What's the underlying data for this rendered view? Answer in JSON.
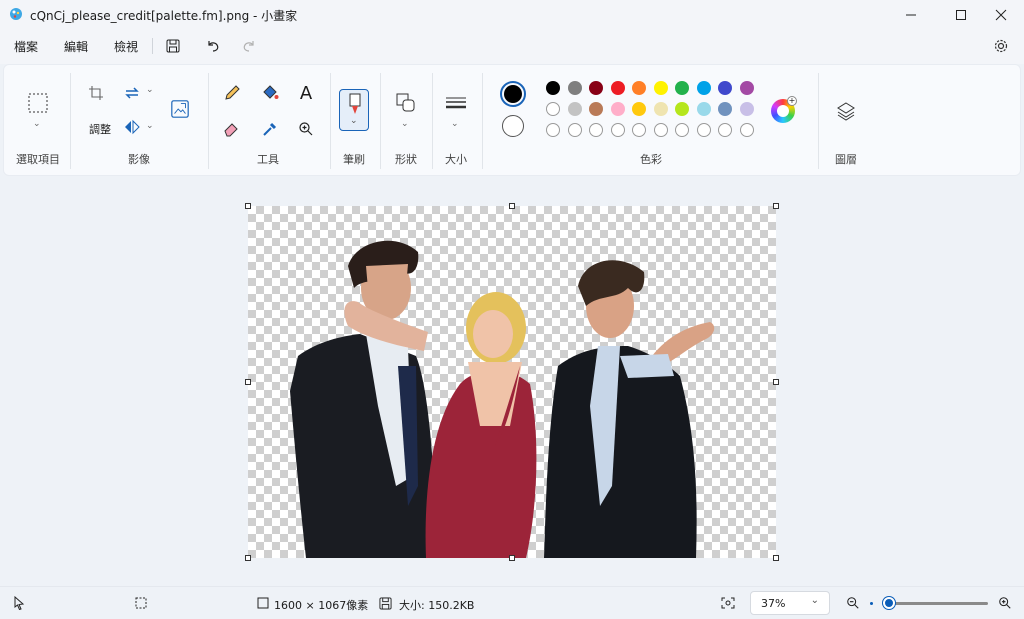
{
  "window": {
    "title": "cQnCj_please_credit[palette.fm].png - 小畫家"
  },
  "menu": {
    "file": "檔案",
    "edit": "編輯",
    "view": "檢視"
  },
  "ribbon": {
    "groups": {
      "select": "選取項目",
      "image": "影像",
      "tools": "工具",
      "brushes": "筆刷",
      "shapes": "形狀",
      "size": "大小",
      "colors": "色彩",
      "layers": "圖層"
    },
    "resize_label": "調整"
  },
  "palette": {
    "primary": "#000000",
    "secondary": "#ffffff",
    "row1": [
      "#000000",
      "#7f7f7f",
      "#880015",
      "#ed1c24",
      "#ff7f27",
      "#fff200",
      "#22b14c",
      "#00a2e8",
      "#3f48cc",
      "#a349a4"
    ],
    "row2": [
      "#ffffff",
      "#c3c3c3",
      "#b97a57",
      "#ffaec9",
      "#ffc90e",
      "#efe4b0",
      "#b5e61d",
      "#99d9ea",
      "#7092be",
      "#c8bfe7"
    ],
    "row3_count": 10
  },
  "status": {
    "dimensions": "1600 × 1067像素",
    "size": "大小: 150.2KB",
    "zoom": "37%"
  },
  "zoom": {
    "level": 0.05
  }
}
